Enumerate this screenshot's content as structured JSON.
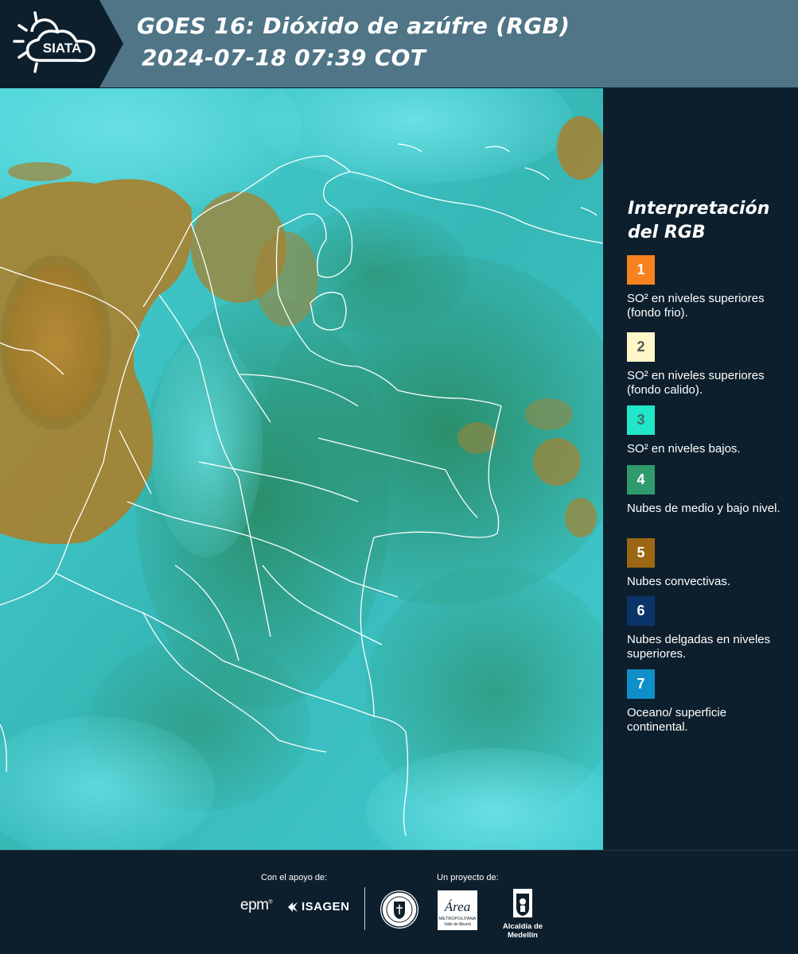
{
  "header": {
    "title_line1": "GOES 16: Dióxido de azúfre (RGB)",
    "title_line2": "2024-07-18 07:39 COT",
    "logo_text": "SIATA",
    "background_color": "#4f7587"
  },
  "map": {
    "description_icon": "satellite-rgb-map",
    "background_color": "#3cc8c8",
    "region_colors": {
      "cloud_tops": "#a7812f",
      "mid_low_clouds": "#2f9a78",
      "surface": "#3cc8c8"
    }
  },
  "legend": {
    "title": "Interpretación del RGB",
    "items": [
      {
        "number": "1",
        "color": "#f7821e",
        "text_color": "#ffffff",
        "label": "SO² en niveles superiores (fondo frio)."
      },
      {
        "number": "2",
        "color": "#fff7c8",
        "text_color": "#555555",
        "label": "SO² en niveles superiores (fondo calido)."
      },
      {
        "number": "3",
        "color": "#21e6c8",
        "text_color": "#3d6f6f",
        "label": "SO² en niveles bajos."
      },
      {
        "number": "4",
        "color": "#2f9a6c",
        "text_color": "#ffffff",
        "label": "Nubes de medio y bajo nivel."
      },
      {
        "number": "5",
        "color": "#9c6712",
        "text_color": "#ffffff",
        "label": "Nubes convectivas."
      },
      {
        "number": "6",
        "color": "#0b3469",
        "text_color": "#ffffff",
        "label": "Nubes delgadas en niveles superiores."
      },
      {
        "number": "7",
        "color": "#0f8fc8",
        "text_color": "#ffffff",
        "label": "Oceano/ superficie continental."
      }
    ]
  },
  "footer": {
    "support_label": "Con el apoyo de:",
    "project_label": "Un proyecto de:",
    "sponsors": [
      "epm",
      "ISAGEN"
    ],
    "partners": [
      "Área Metropolitana Valle de Aburrá",
      "Alcaldía de Medellín"
    ],
    "area_logo_text": "Área",
    "area_logo_sub": "METROPOLITANA",
    "area_logo_sub2": "Valle de Aburrá",
    "alcaldia_text": "Alcaldía de Medellín"
  }
}
